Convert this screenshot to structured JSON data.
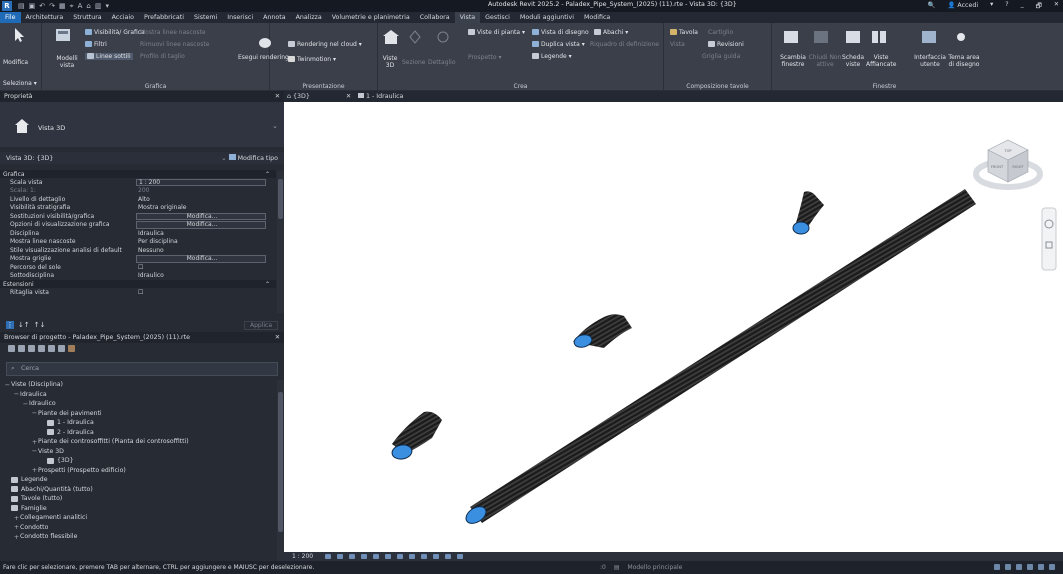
{
  "titlebar": {
    "app_logo": "R",
    "window_title": "Autodesk Revit 2025.2 - Paladex_Pipe_System_(2025) (11).rte - Vista 3D: {3D}",
    "sign_in": "Accedi",
    "minimize": "_",
    "restore": "🗗",
    "close": "✕"
  },
  "ribbon_tabs": [
    "File",
    "Architettura",
    "Struttura",
    "Acciaio",
    "Prefabbricati",
    "Sistemi",
    "Inserisci",
    "Annota",
    "Analizza",
    "Volumetrie e planimetria",
    "Collabora",
    "Vista",
    "Gestisci",
    "Moduli aggiuntivi",
    "Modifica"
  ],
  "active_tab_index": 11,
  "ribbon": {
    "select": "Seleziona",
    "grafica": {
      "label": "Grafica",
      "modifica": "Modifica",
      "modelli_vista": "Modelli vista",
      "visibilita": "Visibilità/ Grafica",
      "filtri": "Filtri",
      "linee_sottili": "Linee sottili",
      "mostra_linee_nascoste": "Mostra linee nascoste",
      "rimuovi_linee_nascoste": "Rimuovi linee nascoste",
      "profilo_taglio": "Profilo di taglio"
    },
    "presentazione": {
      "label": "Presentazione",
      "rendering": "Rendering",
      "rendering_cloud": "Rendering nel cloud",
      "esegui_rendering": "Esegui rendering",
      "twinmotion": "Twinmotion"
    },
    "crea": {
      "label": "Crea",
      "viste_3d": "Viste 3D",
      "sezione": "Sezione",
      "dettaglio": "Dettaglio",
      "viste_di_pianta": "Viste di pianta",
      "prospetto": "Prospetto",
      "vista_di_disegno": "Vista di disegno",
      "duplica_vista": "Duplica vista",
      "legende": "Legende",
      "riquadro": "Riquadro di definizione",
      "abachi": "Abachi"
    },
    "composizione": {
      "label": "Composizione tavole",
      "tavola": "Tavola",
      "cartiglio": "Cartiglio",
      "revisioni": "Revisioni",
      "vista": "Vista",
      "griglia_guida": "Griglia guida"
    },
    "finestre": {
      "label": "Finestre",
      "scambia_finestre": "Scambia finestre",
      "chiudi_non_attive": "Chiudi Non attive",
      "scheda_viste": "Scheda viste",
      "viste_affiancate": "Viste Affiancate",
      "interfaccia_utente": "Interfaccia utente",
      "tema_area": "Tema area di disegno"
    }
  },
  "properties": {
    "panel_title": "Proprietà",
    "type_name": "Vista 3D",
    "selector": "Vista 3D: {3D}",
    "edit_type": "Modifica tipo",
    "section_grafica": "Grafica",
    "rows": [
      {
        "k": "Scala vista",
        "v": "1 : 200",
        "style": "box"
      },
      {
        "k": "Scala: 1:",
        "v": "200",
        "style": "dim"
      },
      {
        "k": "Livello di dettaglio",
        "v": "Alto",
        "style": ""
      },
      {
        "k": "Visibilità stratigrafia",
        "v": "Mostra originale",
        "style": ""
      },
      {
        "k": "Sostituzioni visibilità/grafica",
        "v": "Modifica...",
        "style": "btn"
      },
      {
        "k": "Opzioni di visualizzazione grafica",
        "v": "Modifica...",
        "style": "btn"
      },
      {
        "k": "Disciplina",
        "v": "Idraulica",
        "style": ""
      },
      {
        "k": "Mostra linee nascoste",
        "v": "Per disciplina",
        "style": ""
      },
      {
        "k": "Stile visualizzazione analisi di default",
        "v": "Nessuno",
        "style": ""
      },
      {
        "k": "Mostra griglie",
        "v": "Modifica...",
        "style": "btn"
      },
      {
        "k": "Percorso del sole",
        "v": "☐",
        "style": ""
      },
      {
        "k": "Sottodisciplina",
        "v": "Idraulico",
        "style": ""
      }
    ],
    "section_estensioni": "Estensioni",
    "ritaglia": {
      "k": "Ritaglia vista",
      "v": "☐"
    },
    "apply": "Applica"
  },
  "browser": {
    "panel_title": "Browser di progetto - Paladex_Pipe_System_(2025) (11).rte",
    "search_placeholder": "Cerca",
    "nodes": [
      {
        "label": "Viste (Disciplina)",
        "indent": 0,
        "exp": "−",
        "icon": false
      },
      {
        "label": "Idraulica",
        "indent": 1,
        "exp": "−",
        "icon": false
      },
      {
        "label": "Idraulico",
        "indent": 2,
        "exp": "−",
        "icon": false
      },
      {
        "label": "Piante dei pavimenti",
        "indent": 3,
        "exp": "−",
        "icon": false
      },
      {
        "label": "1 - Idraulica",
        "indent": 4,
        "exp": "",
        "icon": true
      },
      {
        "label": "2 - Idraulica",
        "indent": 4,
        "exp": "",
        "icon": true
      },
      {
        "label": "Piante dei controsoffitti (Pianta dei controsoffitti)",
        "indent": 3,
        "exp": "+",
        "icon": false
      },
      {
        "label": "Viste 3D",
        "indent": 3,
        "exp": "−",
        "icon": false
      },
      {
        "label": "{3D}",
        "indent": 4,
        "exp": "",
        "icon": true
      },
      {
        "label": "Prospetti (Prospetto edificio)",
        "indent": 3,
        "exp": "+",
        "icon": false
      },
      {
        "label": "Legende",
        "indent": 0,
        "exp": "",
        "icon": true
      },
      {
        "label": "Abachi/Quantità (tutto)",
        "indent": 0,
        "exp": "",
        "icon": true
      },
      {
        "label": "Tavole (tutto)",
        "indent": 0,
        "exp": "",
        "icon": true
      },
      {
        "label": "Famiglie",
        "indent": 0,
        "exp": "",
        "icon": true
      },
      {
        "label": "Collegamenti analitici",
        "indent": 1,
        "exp": "+",
        "icon": false
      },
      {
        "label": "Condotto",
        "indent": 1,
        "exp": "+",
        "icon": false
      },
      {
        "label": "Condotto flessibile",
        "indent": 1,
        "exp": "+",
        "icon": false
      }
    ]
  },
  "view_tabs": [
    {
      "label": "{3D}",
      "active": true
    },
    {
      "label": "1 - Idraulica",
      "active": false
    }
  ],
  "viewcube": {
    "front": "FRONT",
    "right": "RIGHT",
    "top": "TOP"
  },
  "view_bar": {
    "scale": "1 : 200"
  },
  "status": {
    "message": "Fare clic per selezionare, premere TAB per alternare, CTRL per aggiungere e MAIUSC per deselezionare.",
    "workset": ":0",
    "model": "Modello principale"
  },
  "colors": {
    "accent": "#1f6bb8",
    "pipe": "#1a1a1a",
    "pipe_end": "#3b8fe0"
  }
}
